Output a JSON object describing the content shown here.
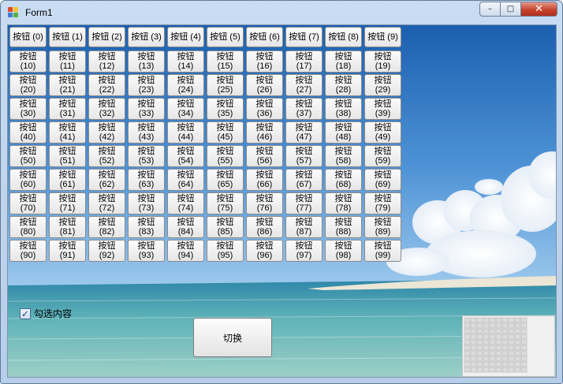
{
  "window": {
    "title": "Form1",
    "controls": {
      "minimize": "–",
      "maximize": "□",
      "close": "✕"
    }
  },
  "buttons": [
    "按钮 (0)",
    "按钮 (1)",
    "按钮 (2)",
    "按钮 (3)",
    "按钮 (4)",
    "按钮 (5)",
    "按钮 (6)",
    "按钮 (7)",
    "按钮 (8)",
    "按钮 (9)",
    "按钮\n(10)",
    "按钮\n(11)",
    "按钮\n(12)",
    "按钮\n(13)",
    "按钮\n(14)",
    "按钮\n(15)",
    "按钮\n(16)",
    "按钮\n(17)",
    "按钮\n(18)",
    "按钮\n(19)",
    "按钮\n(20)",
    "按钮\n(21)",
    "按钮\n(22)",
    "按钮\n(23)",
    "按钮\n(24)",
    "按钮\n(25)",
    "按钮\n(26)",
    "按钮\n(27)",
    "按钮\n(28)",
    "按钮\n(29)",
    "按钮\n(30)",
    "按钮\n(31)",
    "按钮\n(32)",
    "按钮\n(33)",
    "按钮\n(34)",
    "按钮\n(35)",
    "按钮\n(36)",
    "按钮\n(37)",
    "按钮\n(38)",
    "按钮\n(39)",
    "按钮\n(40)",
    "按钮\n(41)",
    "按钮\n(42)",
    "按钮\n(43)",
    "按钮\n(44)",
    "按钮\n(45)",
    "按钮\n(46)",
    "按钮\n(47)",
    "按钮\n(48)",
    "按钮\n(49)",
    "按钮\n(50)",
    "按钮\n(51)",
    "按钮\n(52)",
    "按钮\n(53)",
    "按钮\n(54)",
    "按钮\n(55)",
    "按钮\n(56)",
    "按钮\n(57)",
    "按钮\n(58)",
    "按钮\n(59)",
    "按钮\n(60)",
    "按钮\n(61)",
    "按钮\n(62)",
    "按钮\n(63)",
    "按钮\n(64)",
    "按钮\n(65)",
    "按钮\n(66)",
    "按钮\n(67)",
    "按钮\n(68)",
    "按钮\n(69)",
    "按钮\n(70)",
    "按钮\n(71)",
    "按钮\n(72)",
    "按钮\n(73)",
    "按钮\n(74)",
    "按钮\n(75)",
    "按钮\n(76)",
    "按钮\n(77)",
    "按钮\n(78)",
    "按钮\n(79)",
    "按钮\n(80)",
    "按钮\n(81)",
    "按钮\n(82)",
    "按钮\n(83)",
    "按钮\n(84)",
    "按钮\n(85)",
    "按钮\n(86)",
    "按钮\n(87)",
    "按钮\n(88)",
    "按钮\n(89)",
    "按钮\n(90)",
    "按钮\n(91)",
    "按钮\n(92)",
    "按钮\n(93)",
    "按钮\n(94)",
    "按钮\n(95)",
    "按钮\n(96)",
    "按钮\n(97)",
    "按钮\n(98)",
    "按钮\n(99)"
  ],
  "checkbox": {
    "label": "勾选内容",
    "checked": true
  },
  "switch_button": {
    "label": "切换"
  },
  "colors": {
    "sky_top": "#1c5fb0",
    "sky_mid": "#4f93d6",
    "sea": "#3f9aa6",
    "sand": "#e8e2d4"
  }
}
